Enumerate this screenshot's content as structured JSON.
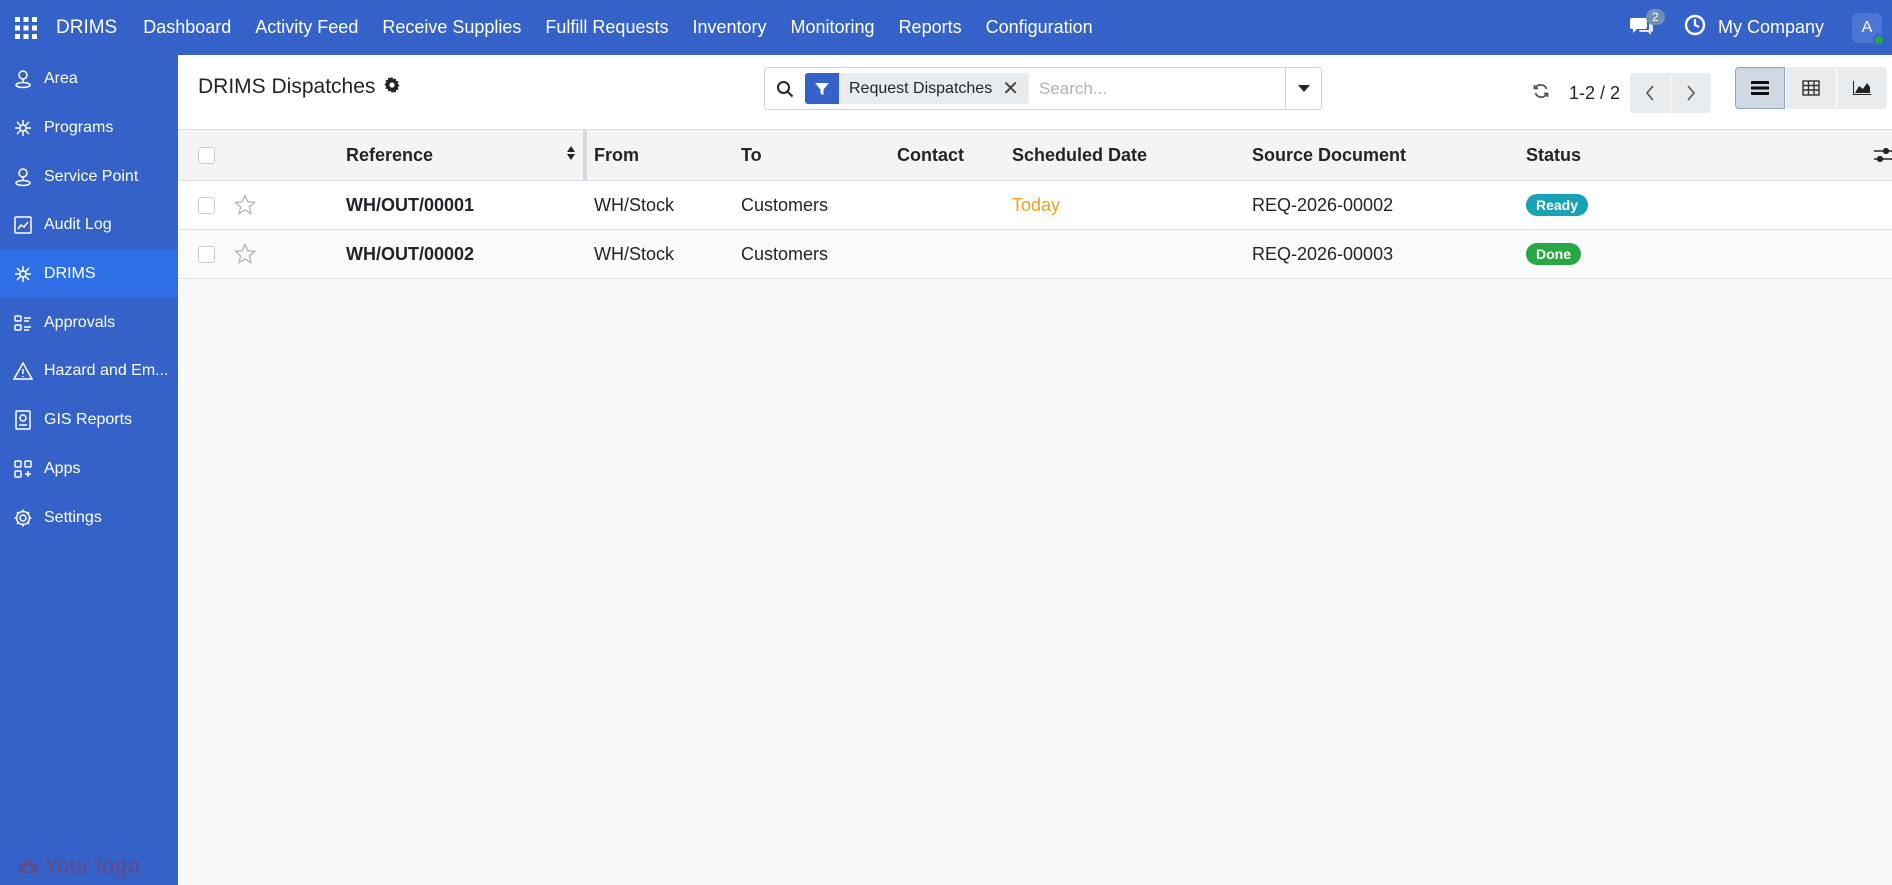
{
  "app": {
    "brand": "DRIMS"
  },
  "topmenu": [
    {
      "label": "Dashboard"
    },
    {
      "label": "Activity Feed"
    },
    {
      "label": "Receive Supplies"
    },
    {
      "label": "Fulfill Requests"
    },
    {
      "label": "Inventory"
    },
    {
      "label": "Monitoring"
    },
    {
      "label": "Reports"
    },
    {
      "label": "Configuration"
    }
  ],
  "systray": {
    "messages_count": "2",
    "company": "My Company",
    "avatar_initial": "A"
  },
  "sidebar": {
    "items": [
      {
        "label": "Area",
        "icon": "area-icon"
      },
      {
        "label": "Programs",
        "icon": "programs-icon"
      },
      {
        "label": "Service Point",
        "icon": "service-point-icon"
      },
      {
        "label": "Audit Log",
        "icon": "audit-log-icon"
      },
      {
        "label": "DRIMS",
        "icon": "drims-icon",
        "active": true
      },
      {
        "label": "Approvals",
        "icon": "approvals-icon"
      },
      {
        "label": "Hazard and Em...",
        "icon": "hazard-icon"
      },
      {
        "label": "GIS Reports",
        "icon": "gis-reports-icon"
      },
      {
        "label": "Apps",
        "icon": "apps-icon"
      },
      {
        "label": "Settings",
        "icon": "settings-icon"
      }
    ],
    "logo_text": "Your logo"
  },
  "control_panel": {
    "title": "DRIMS Dispatches",
    "search": {
      "facet": "Request Dispatches",
      "placeholder": "Search..."
    },
    "pager": {
      "value": "1-2 / 2"
    }
  },
  "table": {
    "columns": [
      "Reference",
      "From",
      "To",
      "Contact",
      "Scheduled Date",
      "Source Document",
      "Status"
    ],
    "rows": [
      {
        "reference": "WH/OUT/00001",
        "from": "WH/Stock",
        "to": "Customers",
        "contact": "",
        "scheduled_date": "Today",
        "source": "REQ-2026-00002",
        "status": "Ready"
      },
      {
        "reference": "WH/OUT/00002",
        "from": "WH/Stock",
        "to": "Customers",
        "contact": "",
        "scheduled_date": "",
        "source": "REQ-2026-00003",
        "status": "Done"
      }
    ]
  },
  "colors": {
    "nav": "#3462c9",
    "active_sidebar": "#2f6fe6",
    "ready": "#17a2b8",
    "done": "#28a745",
    "today": "#f0a020"
  }
}
